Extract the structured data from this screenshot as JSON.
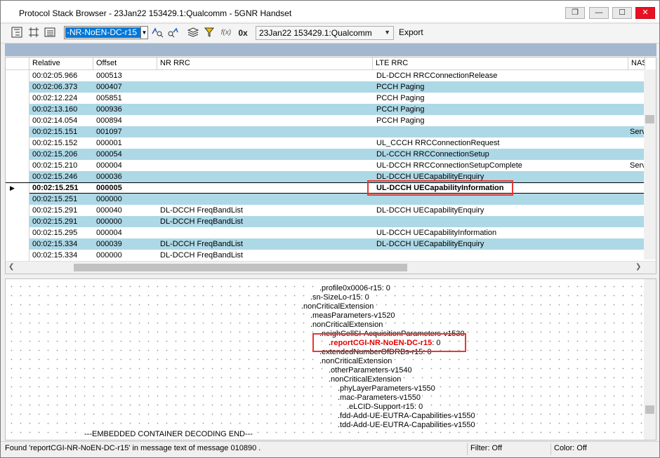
{
  "window": {
    "title": "Protocol Stack Browser  -  23Jan22 153429.1:Qualcomm - 5GNR Handset",
    "controls": [
      "restore-icon",
      "minimize-icon",
      "maximize-icon",
      "close-icon"
    ]
  },
  "toolbar": {
    "search_value": "-NR-NoEN-DC-r15",
    "func_label": "f(x)",
    "hex_label": "0x",
    "log_selected": "23Jan22 153429.1:Qualcomm",
    "export_label": "Export"
  },
  "grid": {
    "columns": [
      "Relative",
      "Offset",
      "NR RRC",
      "LTE RRC",
      "NAS"
    ],
    "rows": [
      {
        "relative": "00:02:05.966",
        "offset": "000513",
        "nr": "",
        "lte": "DL-DCCH RRCConnectionRelease",
        "nas": ""
      },
      {
        "relative": "00:02:06.373",
        "offset": "000407",
        "nr": "",
        "lte": "PCCH Paging",
        "nas": ""
      },
      {
        "relative": "00:02:12.224",
        "offset": "005851",
        "nr": "",
        "lte": "PCCH Paging",
        "nas": ""
      },
      {
        "relative": "00:02:13.160",
        "offset": "000936",
        "nr": "",
        "lte": "PCCH Paging",
        "nas": ""
      },
      {
        "relative": "00:02:14.054",
        "offset": "000894",
        "nr": "",
        "lte": "PCCH Paging",
        "nas": ""
      },
      {
        "relative": "00:02:15.151",
        "offset": "001097",
        "nr": "",
        "lte": "",
        "nas": "Serv"
      },
      {
        "relative": "00:02:15.152",
        "offset": "000001",
        "nr": "",
        "lte": "UL_CCCH RRCConnectionRequest",
        "nas": ""
      },
      {
        "relative": "00:02:15.206",
        "offset": "000054",
        "nr": "",
        "lte": "DL-CCCH RRCConnectionSetup",
        "nas": ""
      },
      {
        "relative": "00:02:15.210",
        "offset": "000004",
        "nr": "",
        "lte": "UL-DCCH RRCConnectionSetupComplete",
        "nas": "Serv"
      },
      {
        "relative": "00:02:15.246",
        "offset": "000036",
        "nr": "",
        "lte": "DL-DCCH UECapabilityEnquiry",
        "nas": ""
      },
      {
        "relative": "00:02:15.251",
        "offset": "000005",
        "nr": "",
        "lte": "UL-DCCH UECapabilityInformation",
        "nas": ""
      },
      {
        "relative": "00:02:15.251",
        "offset": "000000",
        "nr": "",
        "lte": "",
        "nas": ""
      },
      {
        "relative": "00:02:15.291",
        "offset": "000040",
        "nr": "DL-DCCH FreqBandList",
        "lte": "DL-DCCH UECapabilityEnquiry",
        "nas": ""
      },
      {
        "relative": "00:02:15.291",
        "offset": "000000",
        "nr": "DL-DCCH FreqBandList",
        "lte": "",
        "nas": ""
      },
      {
        "relative": "00:02:15.295",
        "offset": "000004",
        "nr": "",
        "lte": "UL-DCCH UECapabilityInformation",
        "nas": ""
      },
      {
        "relative": "00:02:15.334",
        "offset": "000039",
        "nr": "DL-DCCH FreqBandList",
        "lte": "DL-DCCH UECapabilityEnquiry",
        "nas": ""
      },
      {
        "relative": "00:02:15.334",
        "offset": "000000",
        "nr": "DL-DCCH FreqBandList",
        "lte": "",
        "nas": ""
      }
    ]
  },
  "tree": {
    "lines": [
      ".profile0x0006-r15: 0",
      ".sn-SizeLo-r15: 0",
      ".nonCriticalExtension",
      ".measParameters-v1520",
      ".nonCriticalExtension",
      ".neighCellSI-AcquisitionParameters-v1530",
      ".reportCGI-NR-NoEN-DC-r15",
      ": 0",
      ".extendedNumberOfDRBs-r15: 0",
      ".nonCriticalExtension",
      ".otherParameters-v1540",
      ".nonCriticalExtension",
      ".phyLayerParameters-v1550",
      ".mac-Parameters-v1550",
      ".eLCID-Support-r15: 0",
      ".fdd-Add-UE-EUTRA-Capabilities-v1550",
      ".tdd-Add-UE-EUTRA-Capabilities-v1550",
      "---EMBEDDED CONTAINER DECODING END---"
    ]
  },
  "status": {
    "message": "Found 'reportCGI-NR-NoEN-DC-r15' in message text of message 010890 .",
    "filter": "Filter: Off",
    "color": "Color: Off"
  },
  "colors": {
    "row_alt": "#add8e6",
    "header_band": "#a3b7cf",
    "highlight": "#e53935",
    "match_text": "#e00000"
  }
}
